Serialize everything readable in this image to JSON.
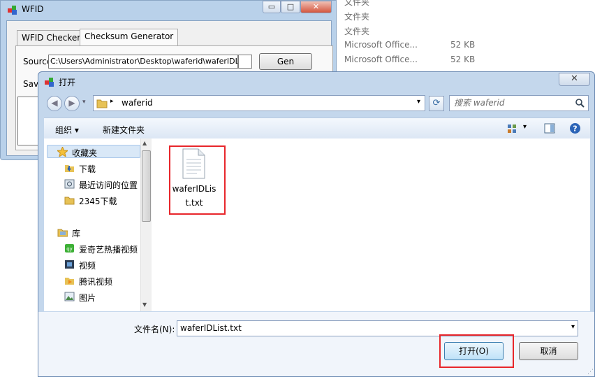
{
  "background_list": {
    "rows": [
      {
        "type": "文件夹",
        "size": ""
      },
      {
        "type": "文件夹",
        "size": ""
      },
      {
        "type": "文件夹",
        "size": ""
      },
      {
        "type": "Microsoft Office...",
        "size": "52 KB"
      },
      {
        "type": "Microsoft Office...",
        "size": "52 KB"
      }
    ]
  },
  "wfid": {
    "title": "WFID",
    "min": "▭",
    "max": "□",
    "close": "✕",
    "tabs": [
      "WFID Checker",
      "Checksum Generator"
    ],
    "source_label": "Source",
    "source_value": "C:\\Users\\Administrator\\Desktop\\waferid\\waferIDList.txt",
    "gen_label": "Gen",
    "save_label": "Save"
  },
  "dialog": {
    "title": "打开",
    "close": "✕",
    "address": "waferid",
    "search_placeholder": "搜索 waferid",
    "toolbar": {
      "organize": "组织 ▾",
      "new_folder": "新建文件夹"
    },
    "nav": {
      "favorites": "收藏夹",
      "favorites_items": [
        "下载",
        "最近访问的位置",
        "2345下载"
      ],
      "libraries": "库",
      "library_items": [
        "爱奇艺热播视频",
        "视频",
        "腾讯视频",
        "图片"
      ]
    },
    "file": {
      "name_line1": "waferIDLis",
      "name_line2": "t.txt"
    },
    "filename_label": "文件名(N):",
    "filename_value": "waferIDList.txt",
    "open_button": "打开(O)",
    "cancel_button": "取消"
  },
  "colors": {
    "highlight": "#e8262b",
    "dialog_frame": "#c4d7ec",
    "nav_selected": "#d9e8f7"
  }
}
